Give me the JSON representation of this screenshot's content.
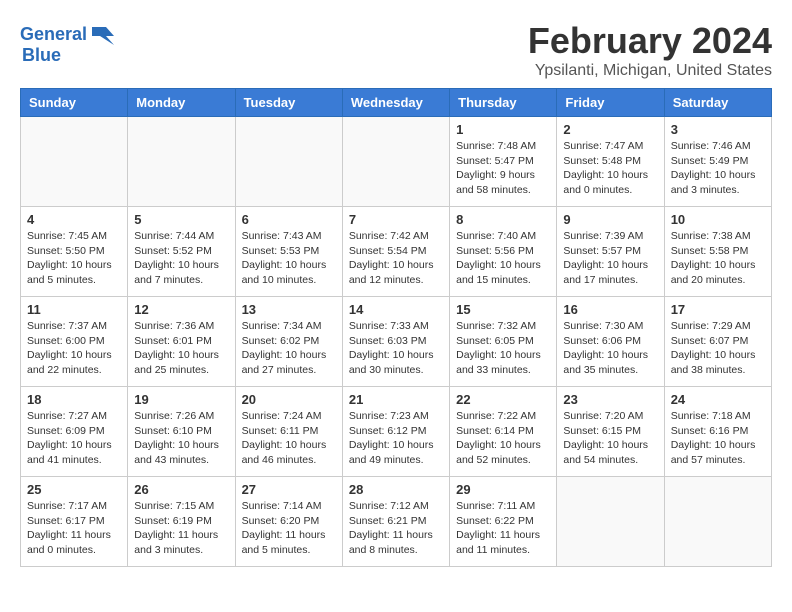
{
  "logo": {
    "text_general": "General",
    "text_blue": "Blue"
  },
  "header": {
    "title": "February 2024",
    "subtitle": "Ypsilanti, Michigan, United States"
  },
  "weekdays": [
    "Sunday",
    "Monday",
    "Tuesday",
    "Wednesday",
    "Thursday",
    "Friday",
    "Saturday"
  ],
  "weeks": [
    [
      {
        "day": "",
        "info": ""
      },
      {
        "day": "",
        "info": ""
      },
      {
        "day": "",
        "info": ""
      },
      {
        "day": "",
        "info": ""
      },
      {
        "day": "1",
        "info": "Sunrise: 7:48 AM\nSunset: 5:47 PM\nDaylight: 9 hours\nand 58 minutes."
      },
      {
        "day": "2",
        "info": "Sunrise: 7:47 AM\nSunset: 5:48 PM\nDaylight: 10 hours\nand 0 minutes."
      },
      {
        "day": "3",
        "info": "Sunrise: 7:46 AM\nSunset: 5:49 PM\nDaylight: 10 hours\nand 3 minutes."
      }
    ],
    [
      {
        "day": "4",
        "info": "Sunrise: 7:45 AM\nSunset: 5:50 PM\nDaylight: 10 hours\nand 5 minutes."
      },
      {
        "day": "5",
        "info": "Sunrise: 7:44 AM\nSunset: 5:52 PM\nDaylight: 10 hours\nand 7 minutes."
      },
      {
        "day": "6",
        "info": "Sunrise: 7:43 AM\nSunset: 5:53 PM\nDaylight: 10 hours\nand 10 minutes."
      },
      {
        "day": "7",
        "info": "Sunrise: 7:42 AM\nSunset: 5:54 PM\nDaylight: 10 hours\nand 12 minutes."
      },
      {
        "day": "8",
        "info": "Sunrise: 7:40 AM\nSunset: 5:56 PM\nDaylight: 10 hours\nand 15 minutes."
      },
      {
        "day": "9",
        "info": "Sunrise: 7:39 AM\nSunset: 5:57 PM\nDaylight: 10 hours\nand 17 minutes."
      },
      {
        "day": "10",
        "info": "Sunrise: 7:38 AM\nSunset: 5:58 PM\nDaylight: 10 hours\nand 20 minutes."
      }
    ],
    [
      {
        "day": "11",
        "info": "Sunrise: 7:37 AM\nSunset: 6:00 PM\nDaylight: 10 hours\nand 22 minutes."
      },
      {
        "day": "12",
        "info": "Sunrise: 7:36 AM\nSunset: 6:01 PM\nDaylight: 10 hours\nand 25 minutes."
      },
      {
        "day": "13",
        "info": "Sunrise: 7:34 AM\nSunset: 6:02 PM\nDaylight: 10 hours\nand 27 minutes."
      },
      {
        "day": "14",
        "info": "Sunrise: 7:33 AM\nSunset: 6:03 PM\nDaylight: 10 hours\nand 30 minutes."
      },
      {
        "day": "15",
        "info": "Sunrise: 7:32 AM\nSunset: 6:05 PM\nDaylight: 10 hours\nand 33 minutes."
      },
      {
        "day": "16",
        "info": "Sunrise: 7:30 AM\nSunset: 6:06 PM\nDaylight: 10 hours\nand 35 minutes."
      },
      {
        "day": "17",
        "info": "Sunrise: 7:29 AM\nSunset: 6:07 PM\nDaylight: 10 hours\nand 38 minutes."
      }
    ],
    [
      {
        "day": "18",
        "info": "Sunrise: 7:27 AM\nSunset: 6:09 PM\nDaylight: 10 hours\nand 41 minutes."
      },
      {
        "day": "19",
        "info": "Sunrise: 7:26 AM\nSunset: 6:10 PM\nDaylight: 10 hours\nand 43 minutes."
      },
      {
        "day": "20",
        "info": "Sunrise: 7:24 AM\nSunset: 6:11 PM\nDaylight: 10 hours\nand 46 minutes."
      },
      {
        "day": "21",
        "info": "Sunrise: 7:23 AM\nSunset: 6:12 PM\nDaylight: 10 hours\nand 49 minutes."
      },
      {
        "day": "22",
        "info": "Sunrise: 7:22 AM\nSunset: 6:14 PM\nDaylight: 10 hours\nand 52 minutes."
      },
      {
        "day": "23",
        "info": "Sunrise: 7:20 AM\nSunset: 6:15 PM\nDaylight: 10 hours\nand 54 minutes."
      },
      {
        "day": "24",
        "info": "Sunrise: 7:18 AM\nSunset: 6:16 PM\nDaylight: 10 hours\nand 57 minutes."
      }
    ],
    [
      {
        "day": "25",
        "info": "Sunrise: 7:17 AM\nSunset: 6:17 PM\nDaylight: 11 hours\nand 0 minutes."
      },
      {
        "day": "26",
        "info": "Sunrise: 7:15 AM\nSunset: 6:19 PM\nDaylight: 11 hours\nand 3 minutes."
      },
      {
        "day": "27",
        "info": "Sunrise: 7:14 AM\nSunset: 6:20 PM\nDaylight: 11 hours\nand 5 minutes."
      },
      {
        "day": "28",
        "info": "Sunrise: 7:12 AM\nSunset: 6:21 PM\nDaylight: 11 hours\nand 8 minutes."
      },
      {
        "day": "29",
        "info": "Sunrise: 7:11 AM\nSunset: 6:22 PM\nDaylight: 11 hours\nand 11 minutes."
      },
      {
        "day": "",
        "info": ""
      },
      {
        "day": "",
        "info": ""
      }
    ]
  ]
}
